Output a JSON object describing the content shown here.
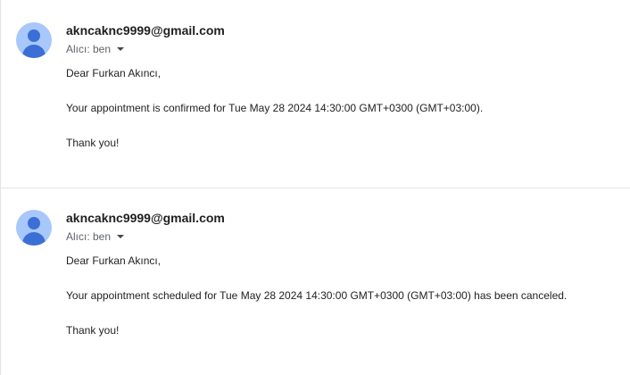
{
  "messages": [
    {
      "sender": "akncaknc9999@gmail.com",
      "recipient_label": "Alıcı: ben",
      "greeting": "Dear Furkan Akıncı,",
      "body": "Your appointment is confirmed for Tue May 28 2024 14:30:00 GMT+0300 (GMT+03:00).",
      "closing": "Thank you!"
    },
    {
      "sender": "akncaknc9999@gmail.com",
      "recipient_label": "Alıcı: ben",
      "greeting": "Dear Furkan Akıncı,",
      "body": "Your appointment scheduled for Tue May 28 2024 14:30:00 GMT+0300 (GMT+03:00) has been canceled.",
      "closing": "Thank you!"
    }
  ],
  "icons": {
    "avatar": "person-avatar-icon",
    "recipient_toggle": "caret-down-icon"
  },
  "colors": {
    "avatar_background": "#a8c7fa",
    "avatar_figure": "#3b6fd6"
  }
}
